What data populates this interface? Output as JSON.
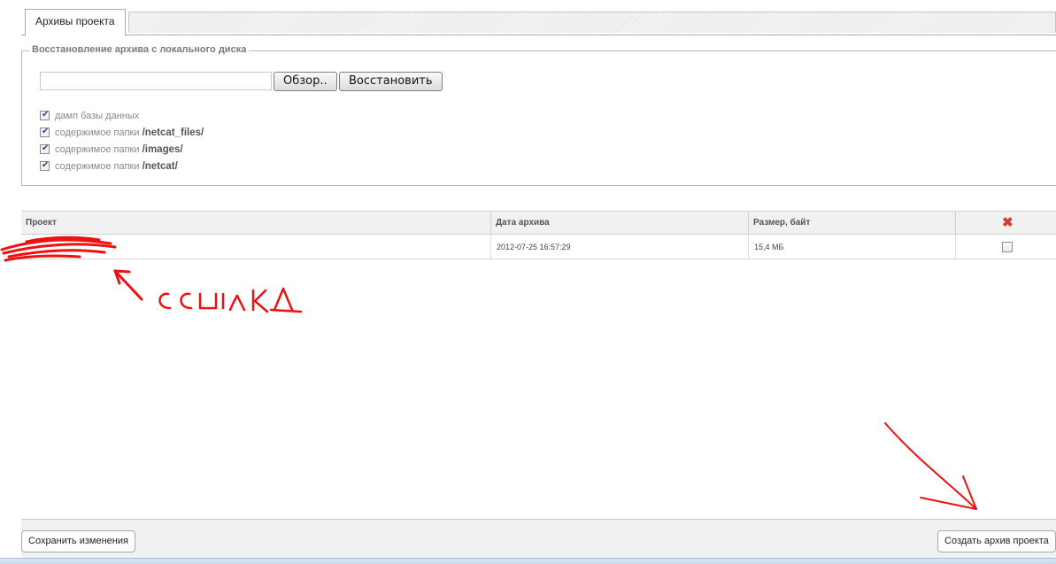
{
  "tabs": [
    {
      "label": "Архивы проекта",
      "active": true
    }
  ],
  "restore_section": {
    "legend": "Восстановление архива с локального диска",
    "file_input_value": "",
    "browse_label": "Обзор..",
    "restore_label": "Восстановить",
    "options": [
      {
        "prefix": "дамп базы данных",
        "path": "",
        "checked": true
      },
      {
        "prefix": "содержимое папки ",
        "path": "/netcat_files/",
        "checked": true
      },
      {
        "prefix": "содержимое папки ",
        "path": "/images/",
        "checked": true
      },
      {
        "prefix": "содержимое папки ",
        "path": "/netcat/",
        "checked": true
      }
    ]
  },
  "archive_table": {
    "columns": [
      "Проект",
      "Дата архива",
      "Размер, байт",
      "delete-icon"
    ],
    "rows": [
      {
        "project": "",
        "date": "2012-07-25 16:57:29",
        "size": "15,4 МБ",
        "checked": false
      }
    ]
  },
  "footer": {
    "save_label": "Сохранить изменения",
    "create_label": "Создать архив проекта"
  },
  "annotations": {
    "handwritten_note": "ссылка",
    "stroke_color": "#ee1111"
  },
  "colors": {
    "header_bg": "#f1f1f1",
    "border": "#cfcfcf",
    "delete_icon": "#d83a2a"
  }
}
